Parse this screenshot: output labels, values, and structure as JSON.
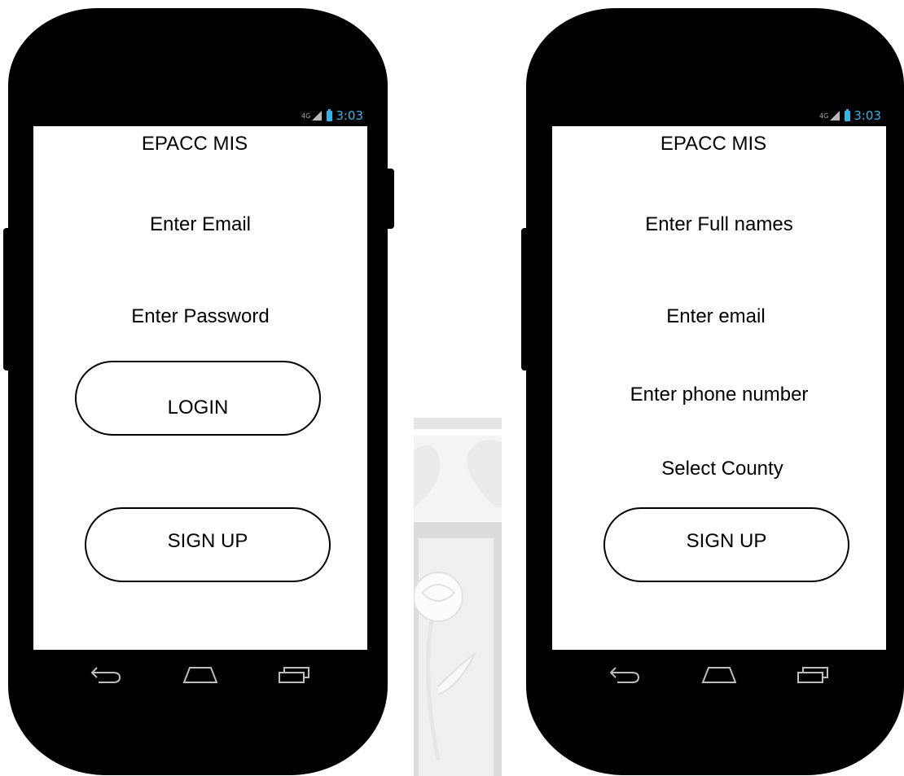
{
  "colors": {
    "status_accent": "#33b5e5",
    "phone_body": "#000000",
    "screen": "#ffffff"
  },
  "left_phone": {
    "status": {
      "network": "4G",
      "time": "3:03"
    },
    "title": "EPACC MIS",
    "fields": [
      {
        "label": "Enter Email"
      },
      {
        "label": "Enter Password"
      }
    ],
    "buttons": {
      "login": "LOGIN",
      "signup": "SIGN UP"
    },
    "nav_icons": [
      "back-icon",
      "home-icon",
      "recent-apps-icon"
    ]
  },
  "right_phone": {
    "status": {
      "network": "4G",
      "time": "3:03"
    },
    "title": "EPACC MIS",
    "fields": [
      {
        "label": "Enter Full names"
      },
      {
        "label": "Enter email"
      },
      {
        "label": "Enter phone number"
      },
      {
        "label": "Select County"
      }
    ],
    "buttons": {
      "signup": "SIGN UP"
    },
    "nav_icons": [
      "back-icon",
      "home-icon",
      "recent-apps-icon"
    ]
  }
}
